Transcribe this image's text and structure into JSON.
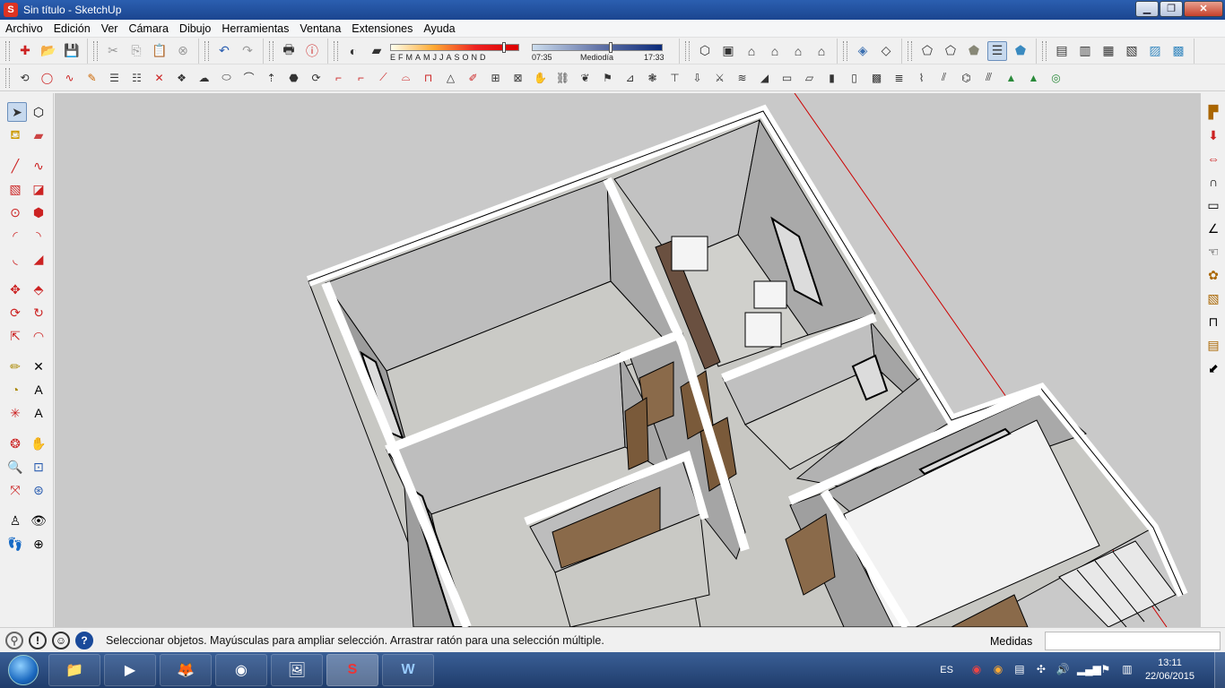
{
  "window": {
    "title": "Sin título - SketchUp",
    "minimize": "▁",
    "maximize": "❐",
    "close": "✕"
  },
  "menu": [
    "Archivo",
    "Edición",
    "Ver",
    "Cámara",
    "Dibujo",
    "Herramientas",
    "Ventana",
    "Extensiones",
    "Ayuda"
  ],
  "shadow_settings": {
    "months": "EFMAMJJASOND",
    "time_start": "07:35",
    "time_mid": "Mediodía",
    "time_end": "17:33",
    "month_level": 0.87,
    "time_level": 0.59
  },
  "status": {
    "message": "Seleccionar objetos. Mayúsculas para ampliar selección. Arrastrar ratón para una selección múltiple.",
    "measures_label": "Medidas",
    "measures_value": ""
  },
  "taskbar": {
    "apps": [
      {
        "name": "explorer",
        "glyph": "📁"
      },
      {
        "name": "media-player",
        "glyph": "▶"
      },
      {
        "name": "firefox",
        "glyph": "🦊"
      },
      {
        "name": "chrome",
        "glyph": "◉"
      },
      {
        "name": "photo-viewer",
        "glyph": "🖼"
      },
      {
        "name": "sketchup",
        "glyph": "S"
      },
      {
        "name": "word",
        "glyph": "W"
      }
    ],
    "language": "ES",
    "time": "13:11",
    "date": "22/06/2015"
  },
  "colors": {
    "viewport_bg": "#c9c9c9",
    "wall_top": "#ffffff",
    "wall_side": "#a8a8a8",
    "floor": "#c8c8c4",
    "door": "#8a6a4a",
    "red_axis": "#cc0000"
  }
}
